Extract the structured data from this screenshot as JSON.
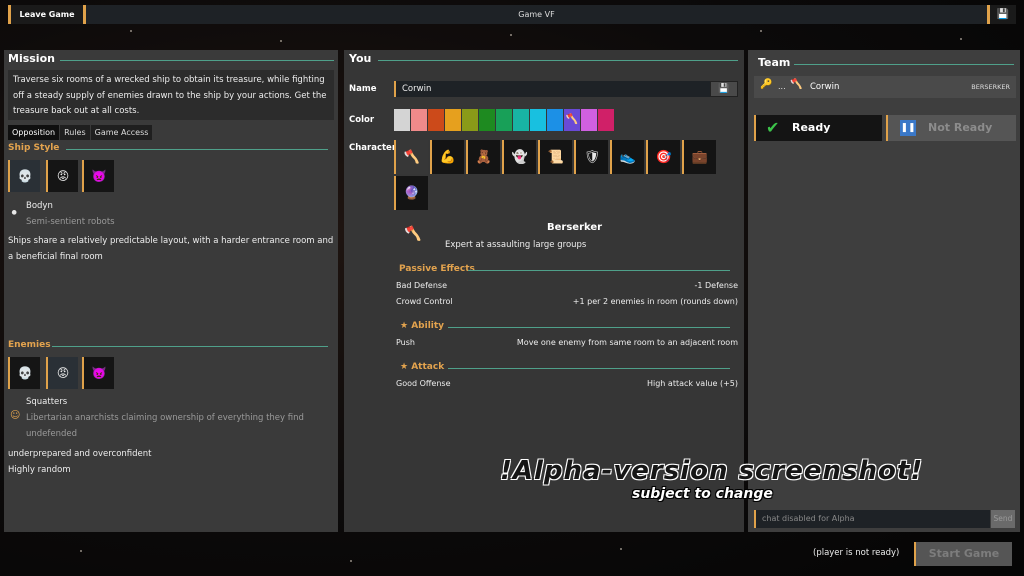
{
  "topbar": {
    "leave_label": "Leave Game",
    "game_title": "Game VF",
    "save_icon": "floppy-disk-icon"
  },
  "mission": {
    "title": "Mission",
    "description": "Traverse six rooms of a wrecked ship to obtain its treasure, while fighting off a steady supply of enemies drawn to the ship by your actions. Get the treasure back out at all costs.",
    "tabs": [
      "Opposition",
      "Rules",
      "Game Access"
    ],
    "ship_style": {
      "heading": "Ship Style",
      "selected_name": "Bodyn",
      "selected_subtitle": "Semi-sentient robots",
      "description": "Ships share a relatively predictable layout, with a harder entrance room and a beneficial final room"
    },
    "enemies": {
      "heading": "Enemies",
      "selected_name": "Squatters",
      "selected_subtitle": "Libertarian anarchists claiming ownership of everything they find undefended",
      "traits": [
        "underprepared and overconfident",
        "Highly random"
      ]
    }
  },
  "you": {
    "title": "You",
    "name_label": "Name",
    "name_value": "Corwin",
    "color_label": "Color",
    "colors": [
      "#d4d4d4",
      "#f08a8a",
      "#cc4a1a",
      "#e6a01e",
      "#8a9a18",
      "#1e8a20",
      "#18a058",
      "#18b4a4",
      "#18c0e0",
      "#1c90e6",
      "#6a4ad6",
      "#d060e0",
      "#d02068"
    ],
    "character_label": "Character",
    "selected_class": {
      "name": "Berserker",
      "description": "Expert at assaulting large groups",
      "passive_heading": "Passive Effects",
      "passives": [
        {
          "name": "Bad Defense",
          "value": "-1 Defense"
        },
        {
          "name": "Crowd Control",
          "value": "+1 per 2 enemies in room (rounds down)"
        }
      ],
      "ability_heading": "Ability",
      "ability": {
        "name": "Push",
        "value": "Move one enemy from same room to an adjacent room"
      },
      "attack_heading": "Attack",
      "attack": {
        "name": "Good Offense",
        "value": "High attack value (+5)"
      }
    }
  },
  "team": {
    "title": "Team",
    "member_name": "Corwin",
    "member_ellipsis": "...",
    "member_class": "BERSERKER",
    "ready_label": "Ready",
    "not_ready_label": "Not Ready",
    "chat_placeholder": "chat disabled for Alpha",
    "send_label": "Send"
  },
  "footer": {
    "status": "(player is not ready)",
    "start_label": "Start Game"
  },
  "watermark": {
    "line1": "!Alpha-version screenshot!",
    "line2": "subject to change"
  }
}
